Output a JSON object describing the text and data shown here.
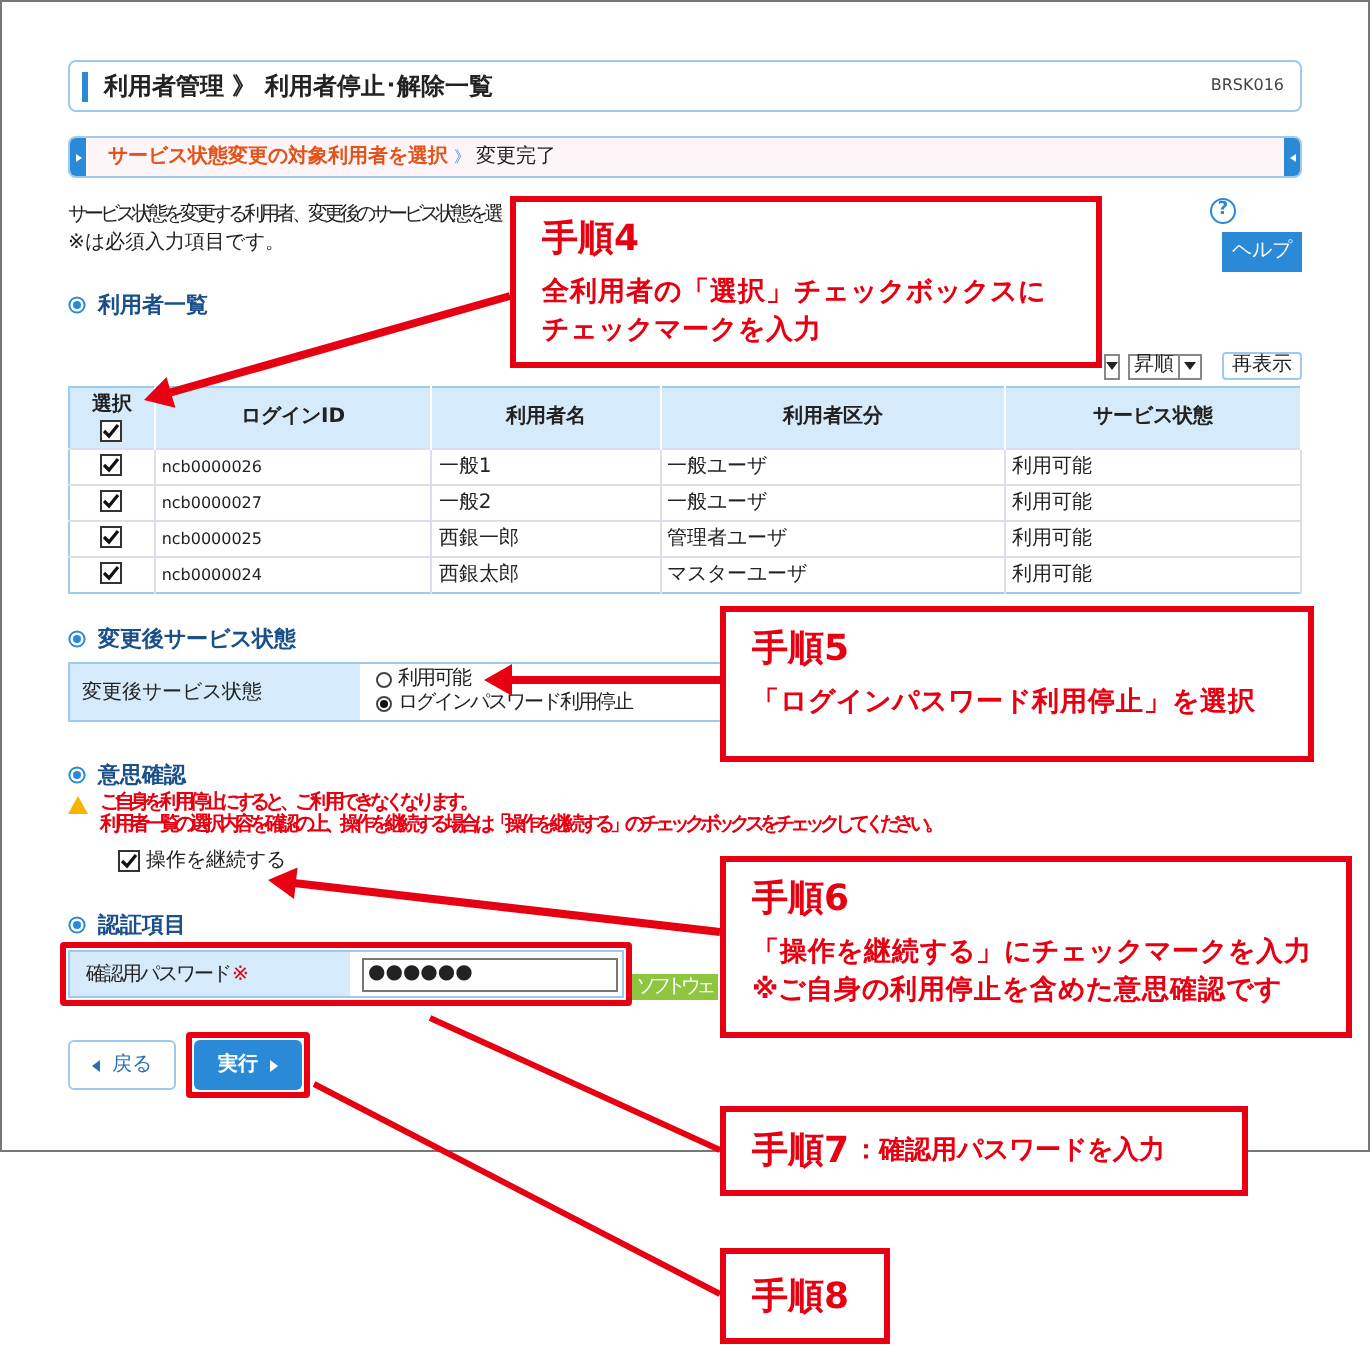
{
  "header": {
    "title": "利用者管理 》 利用者停止･解除一覧",
    "code": "BRSK016"
  },
  "steps": [
    {
      "label": "サービス状態変更の対象利用者を選択",
      "selected": true
    },
    {
      "label": "変更完了",
      "selected": false
    }
  ],
  "step_separator": "》",
  "intro": [
    "サービス状態を変更する利用者、変更後のサービス状態を選",
    "※は必須入力項目です。"
  ],
  "help_mark": "?",
  "help_button": "ヘルプ",
  "user_list": {
    "heading": "利用者一覧",
    "sort_order": "昇順",
    "refresh_button": "再表示",
    "select_column": {
      "label": "選択",
      "checked": true
    },
    "columns": [
      "ログインID",
      "利用者名",
      "利用者区分",
      "サービス状態"
    ],
    "rows": [
      {
        "checked": true,
        "cells": [
          "ncb0000026",
          "一般1",
          "一般ユーザ",
          "利用可能"
        ]
      },
      {
        "checked": true,
        "cells": [
          "ncb0000027",
          "一般2",
          "一般ユーザ",
          "利用可能"
        ]
      },
      {
        "checked": true,
        "cells": [
          "ncb0000025",
          "西銀一郎",
          "管理者ユーザ",
          "利用可能"
        ]
      },
      {
        "checked": true,
        "cells": [
          "ncb0000024",
          "西銀太郎",
          "マスターユーザ",
          "利用可能"
        ]
      }
    ]
  },
  "new_status": {
    "heading": "変更後サービス状態",
    "label": "変更後サービス状態",
    "options": [
      {
        "label": "利用可能",
        "selected": false
      },
      {
        "label": "ログインパスワード利用停止",
        "selected": true
      }
    ]
  },
  "confirmation": {
    "heading": "意思確認",
    "warning": [
      "ご自身を利用停止にすると、ご利用できなくなります。",
      "利用者一覧の選択内容を確認の上、操作を継続する場合は「操作を継続する」のチェックボックスをチェックしてください。"
    ],
    "checkbox": {
      "label": "操作を継続する",
      "checked": true
    }
  },
  "auth": {
    "heading": "認証項目",
    "label": "確認用パスワード",
    "required_mark": "※",
    "value": "●●●●●●",
    "keyboard_button": "ソフトウェ"
  },
  "buttons": {
    "back": "戻る",
    "execute": "実行"
  },
  "callouts": [
    {
      "kind": "block",
      "title": "手順4",
      "lines": [
        "全利用者の「選択」チェックボックスに",
        "チェックマークを入力"
      ]
    },
    {
      "kind": "block",
      "title": "手順5",
      "lines": [
        "「ログインパスワード利用停止」を選択"
      ]
    },
    {
      "kind": "block",
      "title": "手順6",
      "lines": [
        "「操作を継続する」にチェックマークを入力",
        "※ご自身の利用停止を含めた意思確認です"
      ]
    },
    {
      "kind": "inline",
      "title": "手順7",
      "lines": [
        "：確認用パスワードを入力"
      ]
    },
    {
      "kind": "inline",
      "title": "手順8"
    }
  ]
}
